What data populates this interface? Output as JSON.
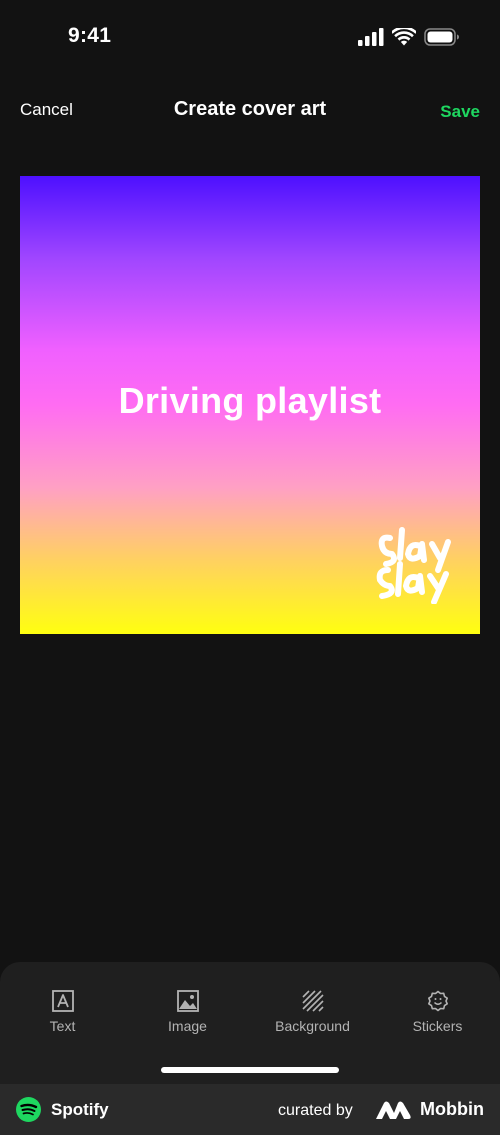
{
  "status_bar": {
    "time": "9:41",
    "icons": [
      "signal-icon",
      "wifi-icon",
      "battery-icon"
    ]
  },
  "header": {
    "cancel_label": "Cancel",
    "title": "Create cover art",
    "save_label": "Save"
  },
  "cover": {
    "title": "Driving playlist",
    "sticker": "slay-sticker",
    "gradient_colors": [
      "#4d10ff",
      "#f060ff",
      "#ffff10"
    ]
  },
  "toolbar": {
    "items": [
      {
        "label": "Text",
        "icon": "text-icon"
      },
      {
        "label": "Image",
        "icon": "image-icon"
      },
      {
        "label": "Background",
        "icon": "background-icon"
      },
      {
        "label": "Stickers",
        "icon": "sticker-icon"
      }
    ]
  },
  "footer": {
    "app_name": "Spotify",
    "curated_by": "curated by",
    "brand": "Mobbin"
  },
  "colors": {
    "accent": "#1ed760",
    "background": "#121212",
    "toolbar": "#1f1f1f"
  }
}
